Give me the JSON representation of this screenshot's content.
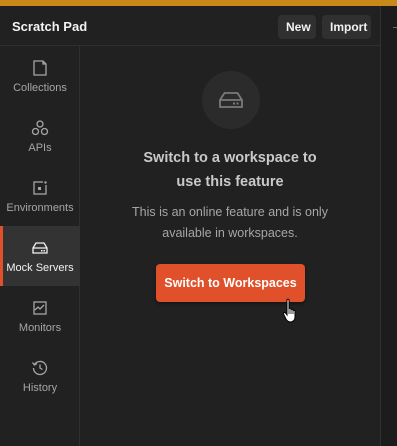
{
  "header": {
    "title": "Scratch Pad",
    "new_label": "New",
    "import_label": "Import"
  },
  "sidebar": {
    "items": [
      {
        "label": "Collections",
        "icon": "collections-icon",
        "active": false
      },
      {
        "label": "APIs",
        "icon": "apis-icon",
        "active": false
      },
      {
        "label": "Environments",
        "icon": "environments-icon",
        "active": false
      },
      {
        "label": "Mock Servers",
        "icon": "mock-servers-icon",
        "active": true
      },
      {
        "label": "Monitors",
        "icon": "monitors-icon",
        "active": false
      },
      {
        "label": "History",
        "icon": "history-icon",
        "active": false
      }
    ]
  },
  "main": {
    "icon": "mock-server-icon",
    "heading_line1": "Switch to a workspace to",
    "heading_line2": "use this feature",
    "description_line1": "This is an online feature and is only",
    "description_line2": "available in workspaces.",
    "cta_label": "Switch to Workspaces"
  },
  "colors": {
    "accent": "#e0502a",
    "top_bar": "#c8891a",
    "background": "#212121"
  }
}
